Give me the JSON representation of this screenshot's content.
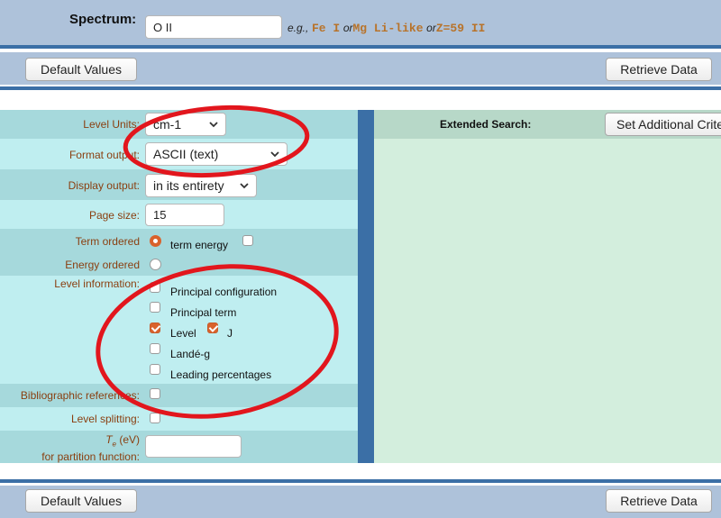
{
  "colors": {
    "header_band": "#aec2da",
    "rule_blue": "#3b6fa6",
    "left_panel_dark": "#a6d9dc",
    "left_panel_light": "#bfeef0",
    "right_panel": "#d3eedd",
    "right_header": "#b7d8c8",
    "accent_orange": "#d9622c",
    "label_brown": "#8a3f10",
    "annotation_red": "#e2161d"
  },
  "spectrum": {
    "label": "Spectrum:",
    "value": "O II",
    "eg_prefix": "e.g.,",
    "ex1": "Fe I",
    "or1": "or",
    "ex2": "Mg Li-like",
    "or2": "or",
    "ex3": "Z=59 II"
  },
  "toolbar_top": {
    "default_values": "Default Values",
    "retrieve_data": "Retrieve Data"
  },
  "toolbar_bottom": {
    "default_values": "Default Values",
    "retrieve_data": "Retrieve Data"
  },
  "form": {
    "level_units": {
      "label": "Level Units:",
      "value": "cm-1"
    },
    "format_output": {
      "label": "Format output:",
      "value": "ASCII (text)"
    },
    "display_output": {
      "label": "Display output:",
      "value": "in its entirety"
    },
    "page_size": {
      "label": "Page size:",
      "value": "15"
    },
    "term_ordered": {
      "label": "Term ordered",
      "extra": "term energy"
    },
    "energy_ordered": {
      "label": "Energy ordered"
    },
    "level_information": {
      "label": "Level information:",
      "principal_configuration": "Principal configuration",
      "principal_term": "Principal term",
      "level": "Level",
      "j": "J",
      "lande_g": "Landé-g",
      "leading_percentages": "Leading percentages"
    },
    "bibliographic_references": {
      "label": "Bibliographic references:"
    },
    "level_splitting": {
      "label": "Level splitting:"
    },
    "te": {
      "label_t": "T",
      "label_sub": "e",
      "label_unit": "(eV)",
      "label_line2": "for partition function:",
      "value": ""
    }
  },
  "extended": {
    "label": "Extended Search:",
    "button": "Set Additional Criteria"
  },
  "icons": {
    "select_arrow": "chevron-down-icon"
  }
}
